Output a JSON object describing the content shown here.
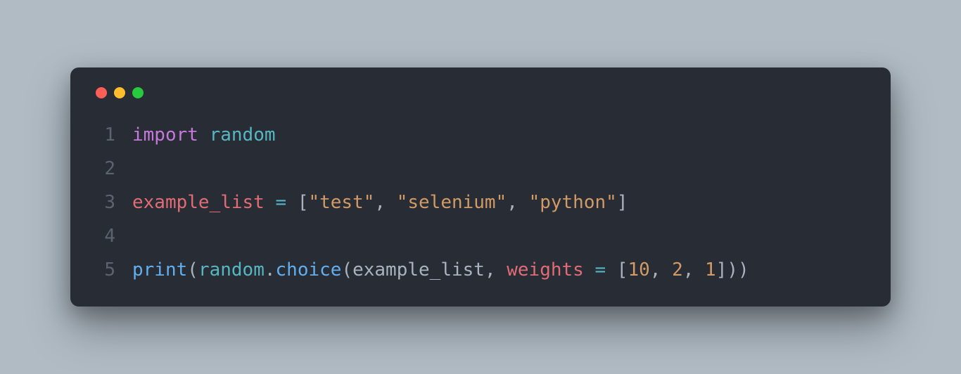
{
  "window": {
    "controls": {
      "close": "close",
      "minimize": "minimize",
      "maximize": "maximize"
    }
  },
  "code": {
    "lines": {
      "l1_num": "1",
      "l1_keyword": "import",
      "l1_module": "random",
      "l2_num": "2",
      "l3_num": "3",
      "l3_var": "example_list",
      "l3_eq": " = ",
      "l3_lb": "[",
      "l3_s1": "\"test\"",
      "l3_c1": ", ",
      "l3_s2": "\"selenium\"",
      "l3_c2": ", ",
      "l3_s3": "\"python\"",
      "l3_rb": "]",
      "l4_num": "4",
      "l5_num": "5",
      "l5_print": "print",
      "l5_p1": "(",
      "l5_random": "random",
      "l5_dot": ".",
      "l5_choice": "choice",
      "l5_p2": "(",
      "l5_arg": "example_list",
      "l5_c1": ", ",
      "l5_weights": "weights",
      "l5_eq": " = ",
      "l5_lb": "[",
      "l5_n1": "10",
      "l5_c2": ", ",
      "l5_n2": "2",
      "l5_c3": ", ",
      "l5_n3": "1",
      "l5_rb": "]",
      "l5_p3": "))"
    }
  }
}
